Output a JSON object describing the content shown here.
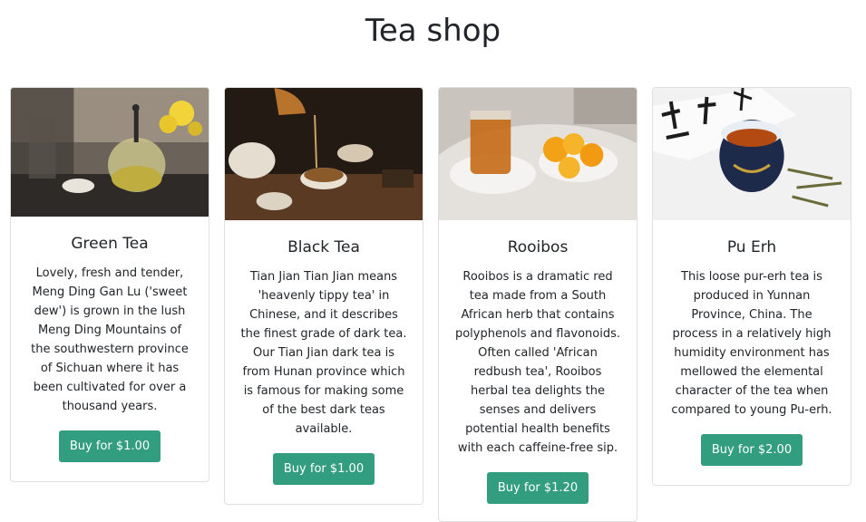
{
  "page": {
    "title": "Tea shop"
  },
  "products": [
    {
      "name": "Green Tea",
      "description": "Lovely, fresh and tender, Meng Ding Gan Lu ('sweet dew') is grown in the lush Meng Ding Mountains of the southwestern province of Sichuan where it has been cultivated for over a thousand years.",
      "button": "Buy for $1.00"
    },
    {
      "name": "Black Tea",
      "description": "Tian Jian Tian Jian means 'heavenly tippy tea' in Chinese, and it describes the finest grade of dark tea. Our Tian Jian dark tea is from Hunan province which is famous for making some of the best dark teas available.",
      "button": "Buy for $1.00"
    },
    {
      "name": "Rooibos",
      "description": "Rooibos is a dramatic red tea made from a South African herb that contains polyphenols and flavonoids. Often called 'African redbush tea', Rooibos herbal tea delights the senses and delivers potential health benefits with each caffeine-free sip.",
      "button": "Buy for $1.20"
    },
    {
      "name": "Pu Erh",
      "description": "This loose pur-erh tea is produced in Yunnan Province, China. The process in a relatively high humidity environment has mellowed the elemental character of the tea when compared to young Pu-erh.",
      "button": "Buy for $2.00"
    }
  ]
}
